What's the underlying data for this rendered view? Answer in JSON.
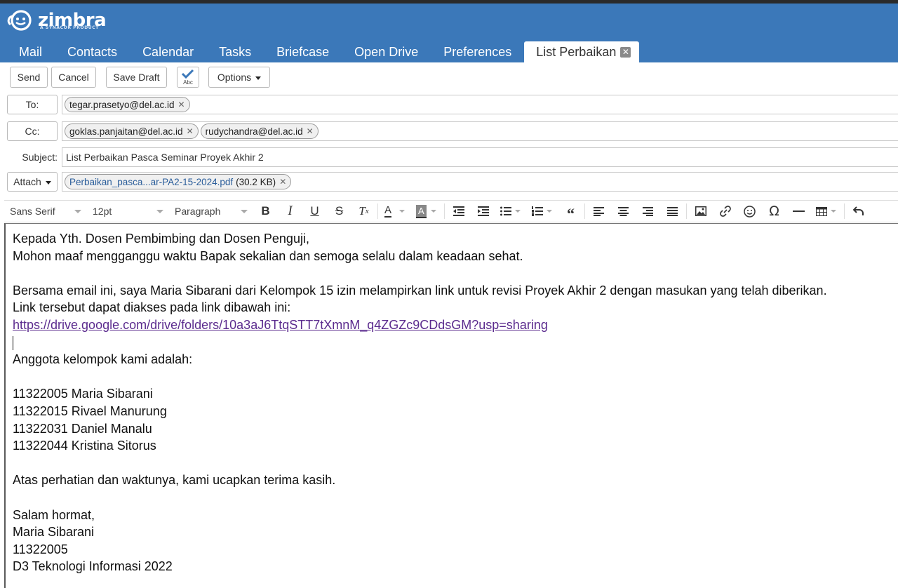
{
  "brand": {
    "name": "zimbra",
    "tagline": "A SYNACOR PRODUCT"
  },
  "tabs": [
    {
      "label": "Mail"
    },
    {
      "label": "Contacts"
    },
    {
      "label": "Calendar"
    },
    {
      "label": "Tasks"
    },
    {
      "label": "Briefcase"
    },
    {
      "label": "Open Drive"
    },
    {
      "label": "Preferences"
    },
    {
      "label": "List Perbaikan",
      "active": true
    }
  ],
  "toolbar": {
    "send": "Send",
    "cancel": "Cancel",
    "save_draft": "Save Draft",
    "spellcheck_text": "Abc",
    "options": "Options"
  },
  "fields": {
    "to_label": "To:",
    "to_recipients": [
      "tegar.prasetyo@del.ac.id"
    ],
    "cc_label": "Cc:",
    "cc_recipients": [
      "goklas.panjaitan@del.ac.id",
      "rudychandra@del.ac.id"
    ],
    "subject_label": "Subject:",
    "subject_value": "List Perbaikan Pasca Seminar Proyek Akhir 2",
    "attach_label": "Attach",
    "attachment": {
      "name": "Perbaikan_pasca...ar-PA2-15-2024.pdf",
      "size": "(30.2 KB)"
    }
  },
  "editor_toolbar": {
    "font_family": "Sans Serif",
    "font_size": "12pt",
    "block_format": "Paragraph"
  },
  "body": {
    "greeting_1": "Kepada Yth. Dosen Pembimbing dan Dosen Penguji,",
    "greeting_2": "Mohon maaf mengganggu waktu Bapak sekalian dan semoga selalu dalam keadaan sehat.",
    "para_1": "Bersama email ini, saya Maria Sibarani dari Kelompok 15 izin melampirkan link untuk revisi Proyek Akhir 2 dengan masukan yang telah diberikan.",
    "para_2": "Link tersebut dapat diakses pada link dibawah ini:",
    "link": "https://drive.google.com/drive/folders/10a3aJ6TtqSTT7tXmnM_q4ZGZc9CDdsGM?usp=sharing",
    "members_intro": "Anggota kelompok kami adalah:",
    "members": [
      "11322005 Maria Sibarani",
      "11322015 Rivael Manurung",
      "11322031 Daniel Manalu",
      "11322044 Kristina Sitorus"
    ],
    "closing": "Atas perhatian dan waktunya, kami ucapkan terima kasih.",
    "sign_1": "Salam hormat,",
    "sign_2": "Maria Sibarani",
    "sign_3": "11322005",
    "sign_4": "D3 Teknologi Informasi 2022"
  },
  "colors": {
    "header_blue": "#3b78b9",
    "spell_underline": "#e03030",
    "link": "#5b2b8e"
  }
}
